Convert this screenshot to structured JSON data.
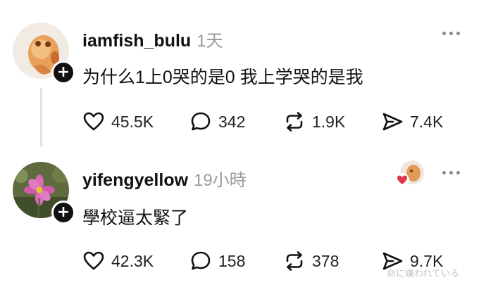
{
  "posts": [
    {
      "username": "iamfish_bulu",
      "timestamp": "1天",
      "body": "为什么1上0哭的是0  我上学哭的是我",
      "avatar": "goldfish-avatar",
      "counts": {
        "likes": "45.5K",
        "replies": "342",
        "reposts": "1.9K",
        "shares": "7.4K"
      }
    },
    {
      "username": "yifengyellow",
      "timestamp": "19小時",
      "body": "學校逼太緊了",
      "avatar": "flower-avatar",
      "liked_by_author": true,
      "counts": {
        "likes": "42.3K",
        "replies": "158",
        "reposts": "378",
        "shares": "9.7K"
      }
    }
  ],
  "follow_badge_symbol": "+",
  "watermark": "命に嫌われている",
  "icons": [
    "heart-icon",
    "comment-icon",
    "repost-icon",
    "share-icon",
    "more-icon",
    "plus-icon"
  ],
  "colors": {
    "text": "#111111",
    "muted": "#9a9a9a",
    "heart_badge": "#e0364a",
    "background": "#ffffff"
  }
}
